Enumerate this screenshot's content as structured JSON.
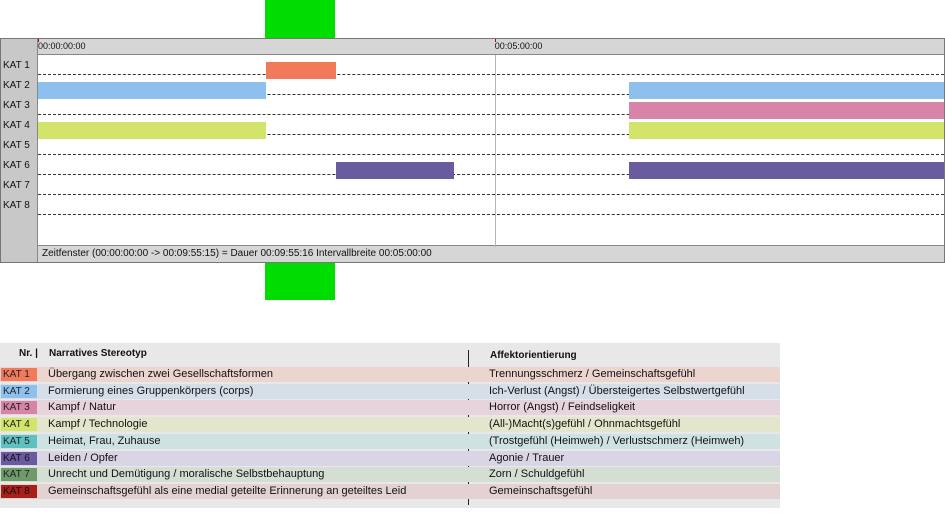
{
  "chart_data": {
    "type": "timeline",
    "time_ruler": [
      "00:00:00:00",
      "00:05:00:00"
    ],
    "x_range_seconds": [
      0,
      595
    ],
    "categories": [
      "KAT 1",
      "KAT 2",
      "KAT 3",
      "KAT 4",
      "KAT 5",
      "KAT 6",
      "KAT 7",
      "KAT 8"
    ],
    "segments": [
      {
        "category": "KAT 1",
        "start": 150,
        "end": 196
      },
      {
        "category": "KAT 2",
        "start": 0,
        "end": 150
      },
      {
        "category": "KAT 2",
        "start": 388,
        "end": 595
      },
      {
        "category": "KAT 3",
        "start": 388,
        "end": 595
      },
      {
        "category": "KAT 4",
        "start": 0,
        "end": 150
      },
      {
        "category": "KAT 4",
        "start": 388,
        "end": 595
      },
      {
        "category": "KAT 6",
        "start": 196,
        "end": 273
      },
      {
        "category": "KAT 6",
        "start": 388,
        "end": 595
      }
    ],
    "highlight_interval": {
      "start": 150,
      "end": 196
    },
    "status_text": "Zeitfenster (00:00:00:00 -> 00:09:55:15) = Dauer 00:09:55:16     Intervallbreite 00:05:00:00"
  },
  "legend": {
    "headers": {
      "nr": "Nr. |",
      "stereotype": "Narratives Stereotyp",
      "affect": "Affektorientierung"
    },
    "rows": [
      {
        "code": "KAT 1",
        "color": "#f07a5a",
        "row_bg": "#ecd4cf",
        "name": "Übergang zwischen zwei Gesellschaftsformen",
        "affect": "Trennungsschmerz / Gemeinschaftsgefühl"
      },
      {
        "code": "KAT 2",
        "color": "#8ec0ee",
        "row_bg": "#d6deea",
        "name": "Formierung eines Gruppenkörpers (corps)",
        "affect": "Ich-Verlust (Angst) / Übersteigertes Selbstwertgefühl"
      },
      {
        "code": "KAT 3",
        "color": "#d884a8",
        "row_bg": "#e6d3dc",
        "name": "Kampf / Natur",
        "affect": "Horror (Angst) / Feindseligkeit"
      },
      {
        "code": "KAT 4",
        "color": "#d4e36a",
        "row_bg": "#e3e6cc",
        "name": "Kampf / Technologie",
        "affect": "(All-)Macht(s)gefühl / Ohnmachtsgefühl"
      },
      {
        "code": "KAT 5",
        "color": "#5ec0c0",
        "row_bg": "#cfe2e2",
        "name": "Heimat, Frau, Zuhause",
        "affect": "(Trostgefühl (Heimweh) / Verlustschmerz (Heimweh)"
      },
      {
        "code": "KAT 6",
        "color": "#6a5aa0",
        "row_bg": "#d9d5e4",
        "name": "Leiden / Opfer",
        "affect": "Agonie / Trauer"
      },
      {
        "code": "KAT 7",
        "color": "#6f9a6a",
        "row_bg": "#d5ded3",
        "name": "Unrecht und Demütigung / moralische Selbstbehauptung",
        "affect": "Zorn / Schuldgefühl"
      },
      {
        "code": "KAT 8",
        "color": "#a82018",
        "row_bg": "#e4d2d2",
        "name": "Gemeinschaftsgefühl als eine medial geteilte Erinnerung an geteiltes Leid",
        "affect": "Gemeinschaftsgefühl"
      }
    ]
  }
}
